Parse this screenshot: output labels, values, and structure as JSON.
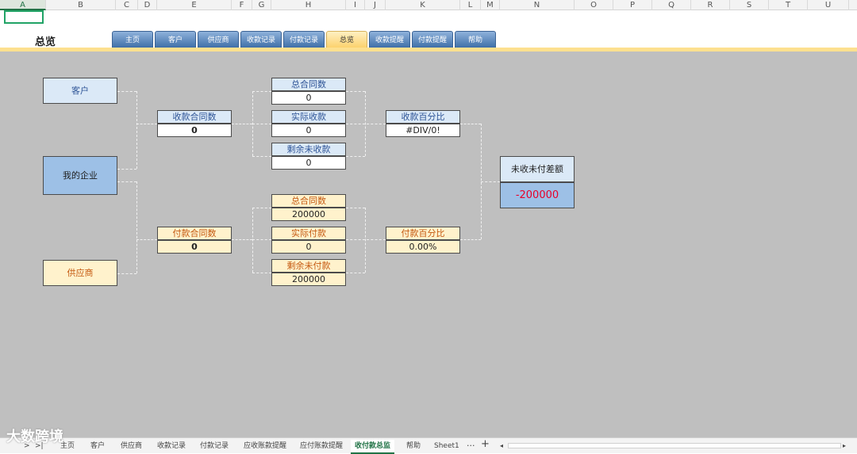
{
  "columns": [
    "A",
    "B",
    "C",
    "D",
    "E",
    "F",
    "G",
    "H",
    "I",
    "J",
    "K",
    "L",
    "M",
    "N",
    "O",
    "P",
    "Q",
    "R",
    "S",
    "T",
    "U"
  ],
  "page_title": "总览",
  "nav_tabs": [
    "主页",
    "客户",
    "供应商",
    "收款记录",
    "付款记录",
    "总览",
    "收款提醒",
    "付款提醒",
    "帮助"
  ],
  "left": {
    "customer": "客户",
    "my_company": "我的企业",
    "supplier": "供应商"
  },
  "receive": {
    "contracts_label": "收款合同数",
    "contracts_value": "0",
    "total_label": "总合同数",
    "total_value": "0",
    "actual_label": "实际收款",
    "actual_value": "0",
    "remaining_label": "剩余未收款",
    "remaining_value": "0",
    "pct_label": "收款百分比",
    "pct_value": "#DIV/0!"
  },
  "pay": {
    "contracts_label": "付款合同数",
    "contracts_value": "0",
    "total_label": "总合同数",
    "total_value": "200000",
    "actual_label": "实际付款",
    "actual_value": "0",
    "remaining_label": "剩余未付款",
    "remaining_value": "200000",
    "pct_label": "付款百分比",
    "pct_value": "0.00%"
  },
  "diff": {
    "label": "未收未付差额",
    "value": "-200000"
  },
  "sheet_tabs": [
    "主页",
    "客户",
    "供应商",
    "收款记录",
    "付款记录",
    "应收账款提醒",
    "应付账款提醒",
    "收付款总监",
    "帮助",
    "Sheet1"
  ],
  "watermark": "大数跨境",
  "colors": {
    "accent": "#217346",
    "negative": "#e8002a"
  }
}
